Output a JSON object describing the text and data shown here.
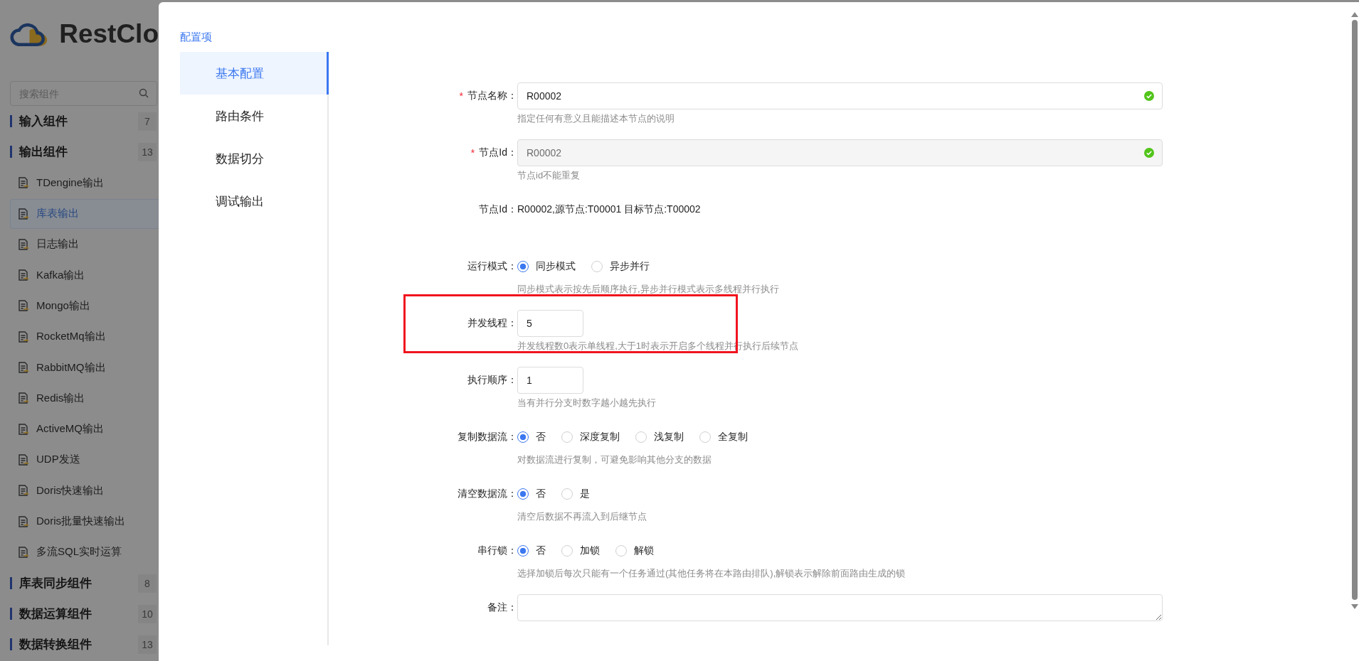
{
  "sidebar": {
    "logo": "RestClo",
    "search": {
      "placeholder": "搜索组件"
    },
    "groups": [
      {
        "label": "输入组件",
        "count": "7"
      },
      {
        "label": "输出组件",
        "count": "13",
        "items": [
          {
            "label": "TDengine输出",
            "selected": false
          },
          {
            "label": "库表输出",
            "selected": true
          },
          {
            "label": "日志输出",
            "selected": false
          },
          {
            "label": "Kafka输出",
            "selected": false
          },
          {
            "label": "Mongo输出",
            "selected": false
          },
          {
            "label": "RocketMq输出",
            "selected": false
          },
          {
            "label": "RabbitMQ输出",
            "selected": false
          },
          {
            "label": "Redis输出",
            "selected": false
          },
          {
            "label": "ActiveMQ输出",
            "selected": false
          },
          {
            "label": "UDP发送",
            "selected": false
          },
          {
            "label": "Doris快速输出",
            "selected": false
          },
          {
            "label": "Doris批量快速输出",
            "selected": false
          },
          {
            "label": "多流SQL实时运算",
            "selected": false
          }
        ]
      },
      {
        "label": "库表同步组件",
        "count": "8"
      },
      {
        "label": "数据运算组件",
        "count": "10"
      },
      {
        "label": "数据转换组件",
        "count": "13"
      }
    ]
  },
  "drawer": {
    "nav_title": "配置项",
    "nav": [
      {
        "label": "基本配置",
        "selected": true
      },
      {
        "label": "路由条件",
        "selected": false
      },
      {
        "label": "数据切分",
        "selected": false
      },
      {
        "label": "调试输出",
        "selected": false
      }
    ],
    "fields": [
      {
        "kind": "text",
        "label": "节点名称：",
        "required_mark": "*",
        "value": "R00002",
        "disabled": false,
        "valid": true,
        "hint": "指定任何有意义且能描述本节点的说明"
      },
      {
        "kind": "text",
        "label": "节点Id：",
        "required_mark": "*",
        "value": "R00002",
        "disabled": true,
        "valid": true,
        "hint": "节点id不能重复"
      },
      {
        "kind": "info",
        "label": "节点Id：",
        "value": "R00002,源节点:T00001 目标节点:T00002"
      },
      {
        "kind": "radio",
        "label": "运行模式：",
        "options": [
          {
            "label": "同步模式",
            "selected": true
          },
          {
            "label": "异步并行",
            "selected": false
          }
        ],
        "hint": "同步模式表示按先后顺序执行,异步并行模式表示多线程并行执行"
      },
      {
        "kind": "number",
        "label": "并发线程：",
        "value": "5",
        "highlighted": true,
        "hint": "并发线程数0表示单线程,大于1时表示开启多个线程并行执行后续节点"
      },
      {
        "kind": "number",
        "label": "执行顺序：",
        "value": "1",
        "highlighted": false,
        "hint": "当有并行分支时数字越小越先执行"
      },
      {
        "kind": "radio",
        "label": "复制数据流：",
        "options": [
          {
            "label": "否",
            "selected": true
          },
          {
            "label": "深度复制",
            "selected": false
          },
          {
            "label": "浅复制",
            "selected": false
          },
          {
            "label": "全复制",
            "selected": false
          }
        ],
        "hint": "对数据流进行复制，可避免影响其他分支的数据"
      },
      {
        "kind": "radio",
        "label": "清空数据流：",
        "options": [
          {
            "label": "否",
            "selected": true
          },
          {
            "label": "是",
            "selected": false
          }
        ],
        "hint": "清空后数据不再流入到后继节点"
      },
      {
        "kind": "radio",
        "label": "串行锁：",
        "options": [
          {
            "label": "否",
            "selected": true
          },
          {
            "label": "加锁",
            "selected": false
          },
          {
            "label": "解锁",
            "selected": false
          }
        ],
        "hint": "选择加锁后每次只能有一个任务通过(其他任务将在本路由排队),解锁表示解除前面路由生成的锁"
      },
      {
        "kind": "textarea",
        "label": "备注："
      }
    ]
  }
}
